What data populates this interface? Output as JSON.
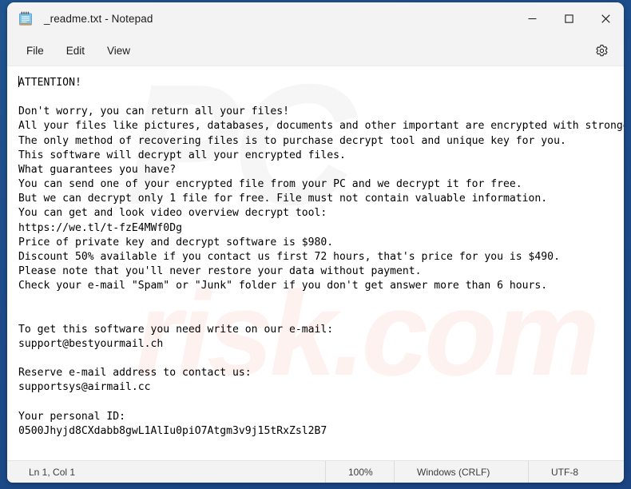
{
  "window": {
    "title": "_readme.txt - Notepad",
    "icon": "notepad-icon",
    "controls": {
      "minimize": "minimize-icon",
      "maximize": "maximize-icon",
      "close": "close-icon"
    }
  },
  "menubar": {
    "items": [
      {
        "label": "File"
      },
      {
        "label": "Edit"
      },
      {
        "label": "View"
      }
    ],
    "settings_icon": "gear-icon"
  },
  "document": {
    "filename": "_readme.txt",
    "content": "ATTENTION!\n\nDon't worry, you can return all your files!\nAll your files like pictures, databases, documents and other important are encrypted with strongest encryption and unique key.\nThe only method of recovering files is to purchase decrypt tool and unique key for you.\nThis software will decrypt all your encrypted files.\nWhat guarantees you have?\nYou can send one of your encrypted file from your PC and we decrypt it for free.\nBut we can decrypt only 1 file for free. File must not contain valuable information.\nYou can get and look video overview decrypt tool:\nhttps://we.tl/t-fzE4MWf0Dg\nPrice of private key and decrypt software is $980.\nDiscount 50% available if you contact us first 72 hours, that's price for you is $490.\nPlease note that you'll never restore your data without payment.\nCheck your e-mail \"Spam\" or \"Junk\" folder if you don't get answer more than 6 hours.\n\n\nTo get this software you need write on our e-mail:\nsupport@bestyourmail.ch\n\nReserve e-mail address to contact us:\nsupportsys@airmail.cc\n\nYour personal ID:\n0500Jhyjd8CXdabb8gwL1AlIu0piO7Atgm3v9j15tRxZsl2B7",
    "ransom_details": {
      "video_url": "https://we.tl/t-fzE4MWf0Dg",
      "price_full": "$980",
      "price_discount": "$490",
      "discount_percent": "50%",
      "discount_window_hours": "72",
      "response_time_hours": "6",
      "free_decrypt_files": "1",
      "primary_email": "support@bestyourmail.ch",
      "reserve_email": "supportsys@airmail.cc",
      "personal_id": "0500Jhyjd8CXdabb8gwL1AlIu0piO7Atgm3v9j15tRxZsl2B7"
    }
  },
  "statusbar": {
    "position": "Ln 1, Col 1",
    "zoom": "100%",
    "line_ending": "Windows (CRLF)",
    "encoding": "UTF-8"
  },
  "watermark": {
    "upper": "PC",
    "lower": "risk.com"
  },
  "colors": {
    "desktop": "#1e4e8c",
    "chrome": "#f3f3f3",
    "text": "#000000",
    "close_hover": "#e81123"
  }
}
